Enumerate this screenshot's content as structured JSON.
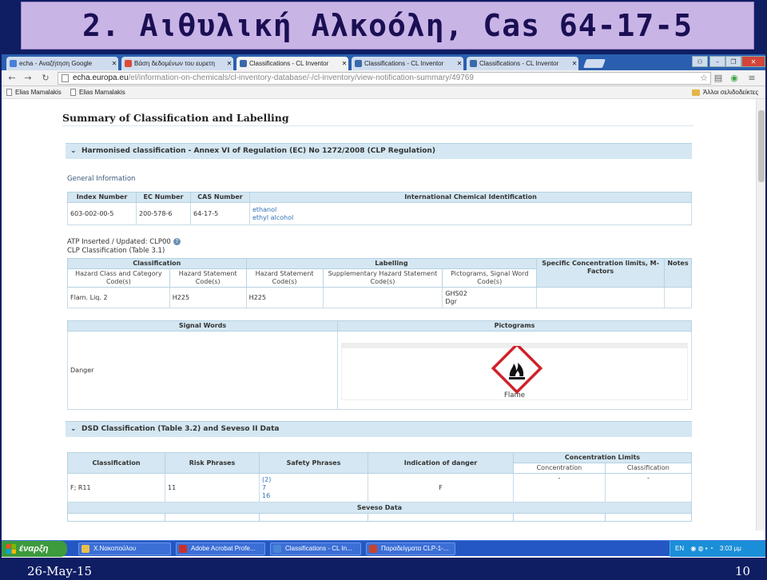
{
  "slide": {
    "title": "2. Αιθυλική Αλκοόλη, Cas 64-17-5",
    "date": "26-May-15",
    "page_number": "10"
  },
  "browser": {
    "tabs": [
      {
        "label": "echa - Αναζήτηση Google",
        "favicon_color": "#4a7fd6",
        "active": false
      },
      {
        "label": "Βάση δεδομένων του ευρετη",
        "favicon_color": "#d94a3a",
        "active": false
      },
      {
        "label": "Classifications - CL Inventor",
        "favicon_color": "#3a6aa8",
        "active": true
      },
      {
        "label": "Classifications - CL Inventor",
        "favicon_color": "#3a6aa8",
        "active": false
      },
      {
        "label": "Classifications - CL Inventor",
        "favicon_color": "#3a6aa8",
        "active": false
      }
    ],
    "url_host": "echa.europa.eu",
    "url_path": "/el/information-on-chemicals/cl-inventory-database/-/cl-inventory/view-notification-summary/49769",
    "bookmarks": [
      "Elias Mamalakis",
      "Elias Mamalakis"
    ],
    "other_bookmarks": "Άλλοι σελιδοδείκτες"
  },
  "page": {
    "heading": "Summary of Classification and Labelling",
    "harmonised": {
      "section_title": "Harmonised classification - Annex VI of Regulation (EC) No 1272/2008 (CLP Regulation)",
      "general_info_label": "General Information",
      "id_headers": [
        "Index Number",
        "EC Number",
        "CAS Number",
        "International Chemical Identification"
      ],
      "id_row": {
        "index": "603-002-00-5",
        "ec": "200-578-6",
        "cas": "64-17-5",
        "names": [
          "ethanol",
          "ethyl alcohol"
        ]
      },
      "atp_text": "ATP Inserted / Updated: CLP00",
      "clp_table_text": "CLP Classification (Table 3.1)",
      "class_headers": {
        "classification": "Classification",
        "labelling": "Labelling",
        "specific": "Specific Concentration limits, M-Factors",
        "notes": "Notes",
        "hazard_class": "Hazard Class and Category Code(s)",
        "hazard_statement_cls": "Hazard Statement Code(s)",
        "hazard_statement_lbl": "Hazard Statement Code(s)",
        "supplementary": "Supplementary Hazard Statement Code(s)",
        "pictograms_signal": "Pictograms, Signal Word Code(s)"
      },
      "class_row": {
        "hazard_class": "Flam. Liq. 2",
        "h_cls": "H225",
        "h_lbl": "H225",
        "pictogram_code": "GHS02",
        "signal_code": "Dgr"
      },
      "signal_words_header": "Signal Words",
      "pictograms_header": "Pictograms",
      "signal_word": "Danger",
      "pictogram_caption": "Flame",
      "pictogram_color": "#d0202a"
    },
    "dsd": {
      "section_title": "DSD Classification (Table 3.2) and Seveso II Data",
      "headers": {
        "classification": "Classification",
        "risk": "Risk Phrases",
        "safety": "Safety Phrases",
        "indication": "Indication of danger",
        "conc_limits": "Concentration Limits",
        "concentration": "Concentration",
        "classification_sub": "Classification"
      },
      "row": {
        "classification": "F; R11",
        "risk": "11",
        "safety": [
          "(2)",
          "7",
          "16"
        ],
        "indication": "F",
        "concentration": "-",
        "classification_sub": "-"
      },
      "seveso_header": "Seveso Data"
    }
  },
  "taskbar": {
    "start_label": "έναρξη",
    "tasks": [
      {
        "label": "Χ.Νακοπούλου",
        "icon_color": "#e8c04a"
      },
      {
        "label": "Adobe Acrobat Profe...",
        "icon_color": "#c8302a"
      },
      {
        "label": "Classifications - CL In...",
        "icon_color": "#4a86d8"
      },
      {
        "label": "Παραδείγματα CLP-1-...",
        "icon_color": "#c8452a"
      }
    ],
    "language": "EN",
    "clock": "3:03 μμ"
  }
}
